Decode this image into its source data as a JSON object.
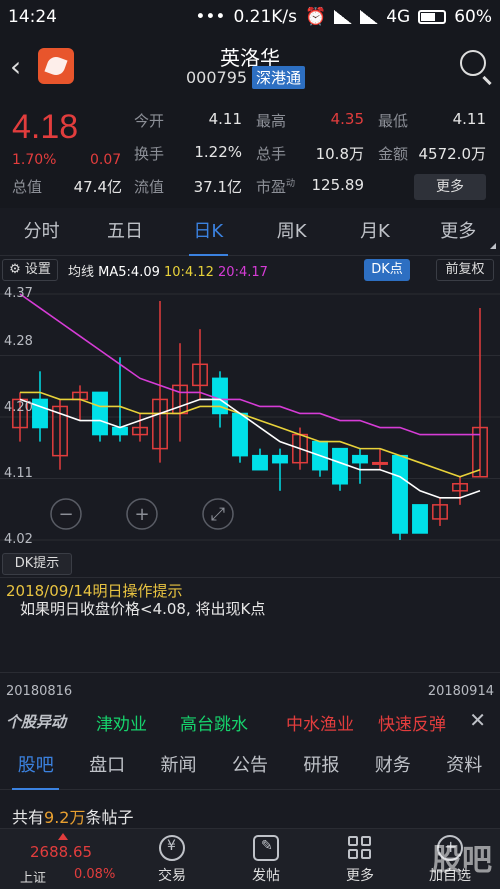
{
  "status": {
    "time": "14:24",
    "speed": "0.21K/s",
    "network": "4G",
    "battery": "60%"
  },
  "header": {
    "name": "英洛华",
    "code": "000795",
    "badge": "深港通"
  },
  "quote": {
    "price": "4.18",
    "change_pct": "1.70%",
    "change_val": "0.07",
    "rows": [
      [
        {
          "label": "今开",
          "value": "4.11"
        },
        {
          "label": "最高",
          "value": "4.35"
        },
        {
          "label": "最低",
          "value": "4.11"
        }
      ],
      [
        {
          "label": "换手",
          "value": "1.22%"
        },
        {
          "label": "总手",
          "value": "10.8万"
        },
        {
          "label": "金额",
          "value": "4572.0万"
        }
      ],
      [
        {
          "label": "总值",
          "value": "47.4亿"
        },
        {
          "label": "流值",
          "value": "37.1亿"
        },
        {
          "label": "市盈",
          "value": "125.89"
        }
      ]
    ],
    "more_label": "更多",
    "pe_sup": "动"
  },
  "period_tabs": [
    "分时",
    "五日",
    "日K",
    "周K",
    "月K",
    "更多"
  ],
  "chart_toolbar": {
    "settings": "设置",
    "ma_label": "均线",
    "ma5": "MA5:4.09",
    "ma10": "10:4.12",
    "ma20": "20:4.17",
    "dk": "DK点",
    "adjust": "前复权"
  },
  "colors": {
    "up": "#e23d3d",
    "down": "#00e0e8",
    "ma5": "#ffffff",
    "ma10": "#e8d23a",
    "ma20": "#d63cd6",
    "accent": "#3b82e0"
  },
  "chart_data": {
    "type": "candlestick",
    "y_labels": [
      "4.37",
      "4.28",
      "4.20",
      "4.11",
      "4.02"
    ],
    "ylim": [
      4.02,
      4.37
    ],
    "x_start": "20180816",
    "x_end": "20180914",
    "candles": [
      {
        "o": 4.18,
        "h": 4.23,
        "l": 4.16,
        "c": 4.22
      },
      {
        "o": 4.22,
        "h": 4.26,
        "l": 4.16,
        "c": 4.18
      },
      {
        "o": 4.14,
        "h": 4.22,
        "l": 4.12,
        "c": 4.21
      },
      {
        "o": 4.22,
        "h": 4.24,
        "l": 4.19,
        "c": 4.23
      },
      {
        "o": 4.23,
        "h": 4.23,
        "l": 4.16,
        "c": 4.17
      },
      {
        "o": 4.18,
        "h": 4.28,
        "l": 4.16,
        "c": 4.17
      },
      {
        "o": 4.17,
        "h": 4.2,
        "l": 4.16,
        "c": 4.18
      },
      {
        "o": 4.15,
        "h": 4.36,
        "l": 4.13,
        "c": 4.22
      },
      {
        "o": 4.2,
        "h": 4.3,
        "l": 4.16,
        "c": 4.24
      },
      {
        "o": 4.24,
        "h": 4.32,
        "l": 4.22,
        "c": 4.27
      },
      {
        "o": 4.25,
        "h": 4.26,
        "l": 4.18,
        "c": 4.2
      },
      {
        "o": 4.2,
        "h": 4.2,
        "l": 4.13,
        "c": 4.14
      },
      {
        "o": 4.14,
        "h": 4.15,
        "l": 4.12,
        "c": 4.12
      },
      {
        "o": 4.14,
        "h": 4.15,
        "l": 4.09,
        "c": 4.13
      },
      {
        "o": 4.13,
        "h": 4.18,
        "l": 4.12,
        "c": 4.17
      },
      {
        "o": 4.16,
        "h": 4.16,
        "l": 4.11,
        "c": 4.12
      },
      {
        "o": 4.15,
        "h": 4.15,
        "l": 4.09,
        "c": 4.1
      },
      {
        "o": 4.14,
        "h": 4.15,
        "l": 4.1,
        "c": 4.13
      },
      {
        "o": 4.13,
        "h": 4.15,
        "l": 4.12,
        "c": 4.13
      },
      {
        "o": 4.14,
        "h": 4.14,
        "l": 4.02,
        "c": 4.03
      },
      {
        "o": 4.07,
        "h": 4.07,
        "l": 4.03,
        "c": 4.03
      },
      {
        "o": 4.05,
        "h": 4.08,
        "l": 4.04,
        "c": 4.07
      },
      {
        "o": 4.09,
        "h": 4.11,
        "l": 4.07,
        "c": 4.1
      },
      {
        "o": 4.11,
        "h": 4.35,
        "l": 4.11,
        "c": 4.18
      }
    ],
    "ma5": [
      4.22,
      4.21,
      4.2,
      4.19,
      4.19,
      4.18,
      4.19,
      4.2,
      4.21,
      4.22,
      4.22,
      4.2,
      4.18,
      4.16,
      4.15,
      4.14,
      4.13,
      4.12,
      4.12,
      4.11,
      4.09,
      4.08,
      4.08,
      4.09
    ],
    "ma10": [
      4.23,
      4.23,
      4.22,
      4.22,
      4.21,
      4.21,
      4.2,
      4.2,
      4.2,
      4.21,
      4.21,
      4.2,
      4.19,
      4.18,
      4.17,
      4.16,
      4.16,
      4.15,
      4.15,
      4.14,
      4.13,
      4.12,
      4.11,
      4.12
    ],
    "ma20": [
      4.37,
      4.35,
      4.33,
      4.31,
      4.29,
      4.27,
      4.25,
      4.24,
      4.23,
      4.23,
      4.22,
      4.22,
      4.21,
      4.21,
      4.2,
      4.2,
      4.19,
      4.19,
      4.18,
      4.18,
      4.17,
      4.17,
      4.17,
      4.17
    ]
  },
  "dk_hint": {
    "button": "DK提示",
    "title": "2018/09/14明日操作提示",
    "body": "如果明日收盘价格<4.08, 将出现K点"
  },
  "movers": {
    "logo": "个股异动",
    "items": [
      {
        "label": "津劝业",
        "color": "#16d26c"
      },
      {
        "label": "高台跳水",
        "color": "#16d26c"
      },
      {
        "label": "中水渔业",
        "color": "#e23d3d"
      },
      {
        "label": "快速反弹",
        "color": "#e23d3d"
      }
    ]
  },
  "news_tabs": [
    "股吧",
    "盘口",
    "新闻",
    "公告",
    "研报",
    "财务",
    "资料"
  ],
  "posts": {
    "prefix": "共有",
    "count": "9.2万",
    "suffix": "条帖子"
  },
  "bottom_nav": {
    "index_value": "2688.65",
    "index_name": "上证",
    "index_pct": "0.08%",
    "items": [
      "交易",
      "发帖",
      "更多",
      "加自选"
    ],
    "watermark": "股吧"
  }
}
